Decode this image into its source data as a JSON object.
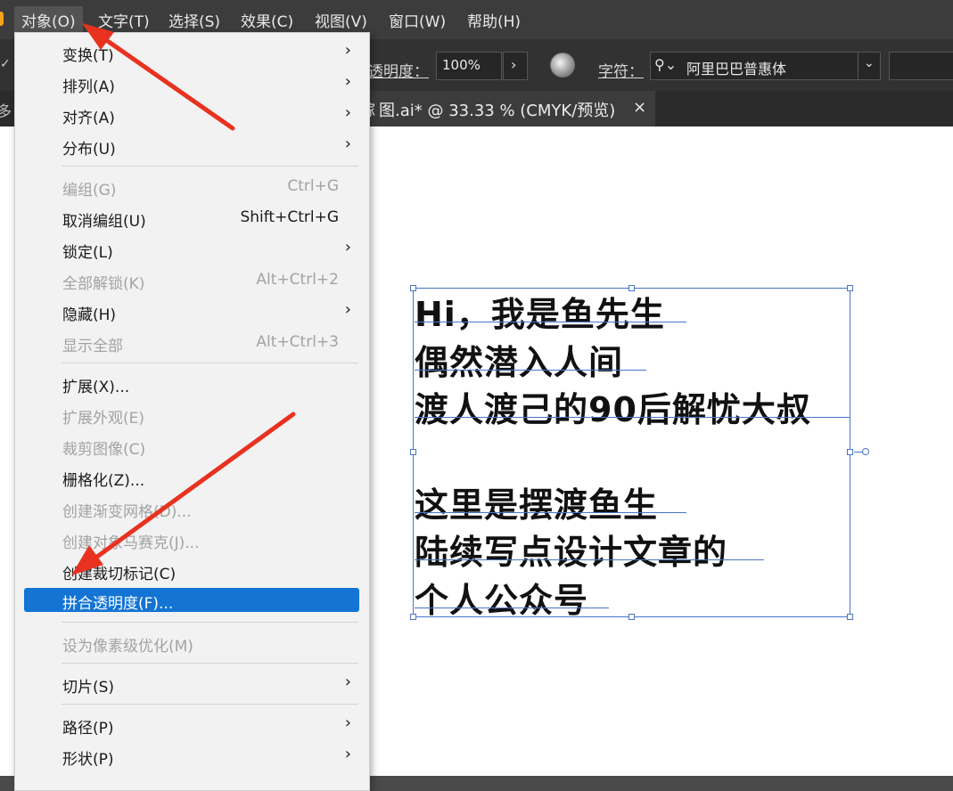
{
  "menubar": {
    "items": [
      "对象(O)",
      "文字(T)",
      "选择(S)",
      "效果(C)",
      "视图(V)",
      "窗口(W)",
      "帮助(H)"
    ]
  },
  "control_bar": {
    "opacity_label": "透明度：",
    "opacity_value": "100%",
    "char_label": "字符：",
    "font_name": "阿里巴巴普惠体"
  },
  "document_tab": {
    "left_fragment": "多",
    "title": "图.ai* @ 33.33 % (CMYK/预览)",
    "title_cut": "稼",
    "close": "×"
  },
  "object_menu": {
    "groups": [
      [
        {
          "label": "变换(T)",
          "submenu": true
        },
        {
          "label": "排列(A)",
          "submenu": true
        },
        {
          "label": "对齐(A)",
          "submenu": true
        },
        {
          "label": "分布(U)",
          "submenu": true
        }
      ],
      [
        {
          "label": "编组(G)",
          "shortcut": "Ctrl+G",
          "disabled": true
        },
        {
          "label": "取消编组(U)",
          "shortcut": "Shift+Ctrl+G"
        },
        {
          "label": "锁定(L)",
          "submenu": true
        },
        {
          "label": "全部解锁(K)",
          "shortcut": "Alt+Ctrl+2",
          "disabled": true
        },
        {
          "label": "隐藏(H)",
          "submenu": true
        },
        {
          "label": "显示全部",
          "shortcut": "Alt+Ctrl+3",
          "disabled": true
        }
      ],
      [
        {
          "label": "扩展(X)..."
        },
        {
          "label": "扩展外观(E)",
          "disabled": true
        },
        {
          "label": "裁剪图像(C)",
          "disabled": true
        },
        {
          "label": "栅格化(Z)..."
        },
        {
          "label": "创建渐变网格(D)...",
          "disabled": true
        },
        {
          "label": "创建对象马赛克(J)...",
          "disabled": true
        },
        {
          "label": "创建裁切标记(C)"
        },
        {
          "label": "拼合透明度(F)...",
          "selected": true
        }
      ],
      [
        {
          "label": "设为像素级优化(M)",
          "disabled": true
        }
      ],
      [
        {
          "label": "切片(S)",
          "submenu": true
        }
      ],
      [
        {
          "label": "路径(P)",
          "submenu": true
        },
        {
          "label": "形状(P)",
          "submenu": true
        }
      ]
    ]
  },
  "artboard_text": {
    "lines": [
      "Hi，我是鱼先生",
      "偶然潜入人间",
      "渡人渡己的90后解忧大叔",
      "",
      "这里是摆渡鱼生",
      "陆续写点设计文章的",
      "个人公众号"
    ]
  },
  "colors": {
    "selection": "#1474d4",
    "arrow": "#e8321f",
    "frame": "#4a74c9"
  }
}
